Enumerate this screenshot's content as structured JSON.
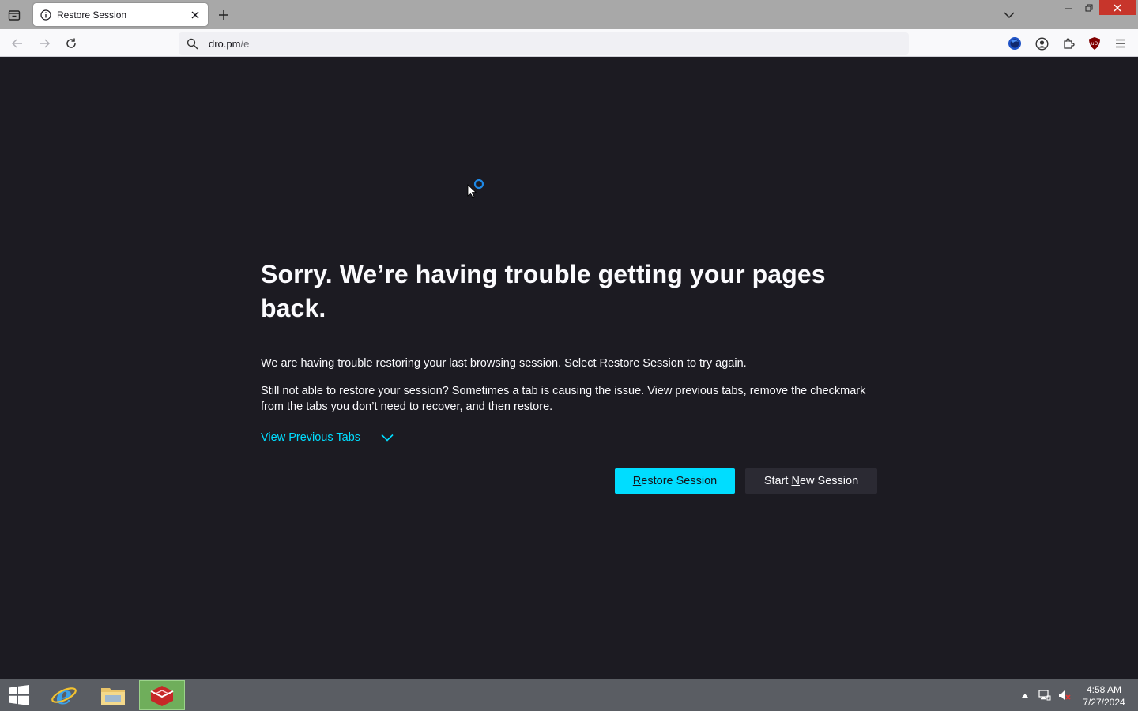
{
  "browser": {
    "tab": {
      "title": "Restore Session",
      "icon": "info-icon"
    },
    "url": {
      "host": "dro.pm",
      "path": "/e"
    }
  },
  "page": {
    "headline": "Sorry. We’re having trouble getting your pages back.",
    "paragraph1": "We are having trouble restoring your last browsing session. Select Restore Session to try again.",
    "paragraph2": "Still not able to restore your session? Sometimes a tab is causing the issue. View previous tabs, remove the checkmark from the tabs you don’t need to recover, and then restore.",
    "view_previous_tabs": "View Previous Tabs",
    "restore_button": {
      "accesskey": "R",
      "rest": "estore Session"
    },
    "new_session_button": {
      "before": "Start ",
      "accesskey": "N",
      "rest": "ew Session"
    }
  },
  "taskbar": {
    "time": "4:58 AM",
    "date": "7/27/2024"
  },
  "colors": {
    "content_bg": "#1c1b22",
    "accent": "#00ddff",
    "secondary_button": "#2b2a33",
    "close_button": "#c7352b"
  }
}
